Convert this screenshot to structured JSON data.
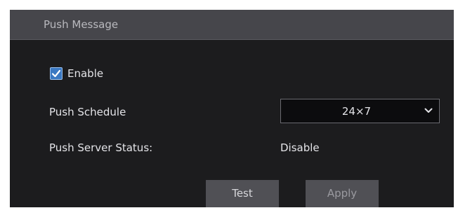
{
  "panel": {
    "title": "Push Message"
  },
  "enable": {
    "label": "Enable",
    "checked": true
  },
  "push_schedule": {
    "label": "Push Schedule",
    "selected": "24×7"
  },
  "push_server_status": {
    "label": "Push Server Status:",
    "value": "Disable"
  },
  "buttons": {
    "test_label": "Test",
    "apply_label": "Apply"
  },
  "icons": {
    "checkbox": "checkmark-icon",
    "select_arrow": "chevron-down-icon"
  },
  "colors": {
    "panel_bg": "#1c1c1e",
    "title_bar": "#46464b",
    "checkbox_accent": "#3a78c2",
    "button_bg": "#505055"
  }
}
